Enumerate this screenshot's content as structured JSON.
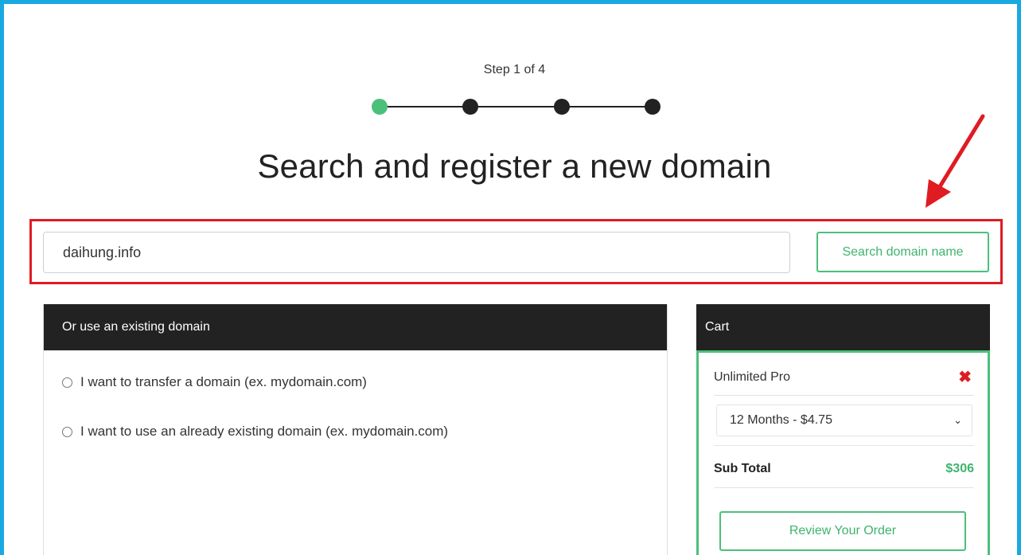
{
  "progress": {
    "step_label": "Step 1 of 4",
    "total_steps": 4,
    "current_step": 1,
    "active_color": "#4cc07a"
  },
  "page_title": "Search and register a new domain",
  "search": {
    "value": "daihung.info",
    "button_label": "Search domain name"
  },
  "existing_domain": {
    "header": "Or use an existing domain",
    "options": [
      {
        "label": "I want to transfer a domain (ex. mydomain.com)",
        "checked": false
      },
      {
        "label": "I want to use an already existing domain (ex. mydomain.com)",
        "checked": false
      }
    ]
  },
  "cart": {
    "header": "Cart",
    "item_name": "Unlimited Pro",
    "remove_icon": "close-icon",
    "billing_cycle": "12 Months - $4.75",
    "subtotal_label": "Sub Total",
    "subtotal_value": "$306",
    "review_button": "Review Your Order"
  },
  "colors": {
    "frame_border": "#1aa8e0",
    "accent_green": "#4cc07a",
    "highlight_red": "#e01b22",
    "header_dark": "#222222"
  }
}
